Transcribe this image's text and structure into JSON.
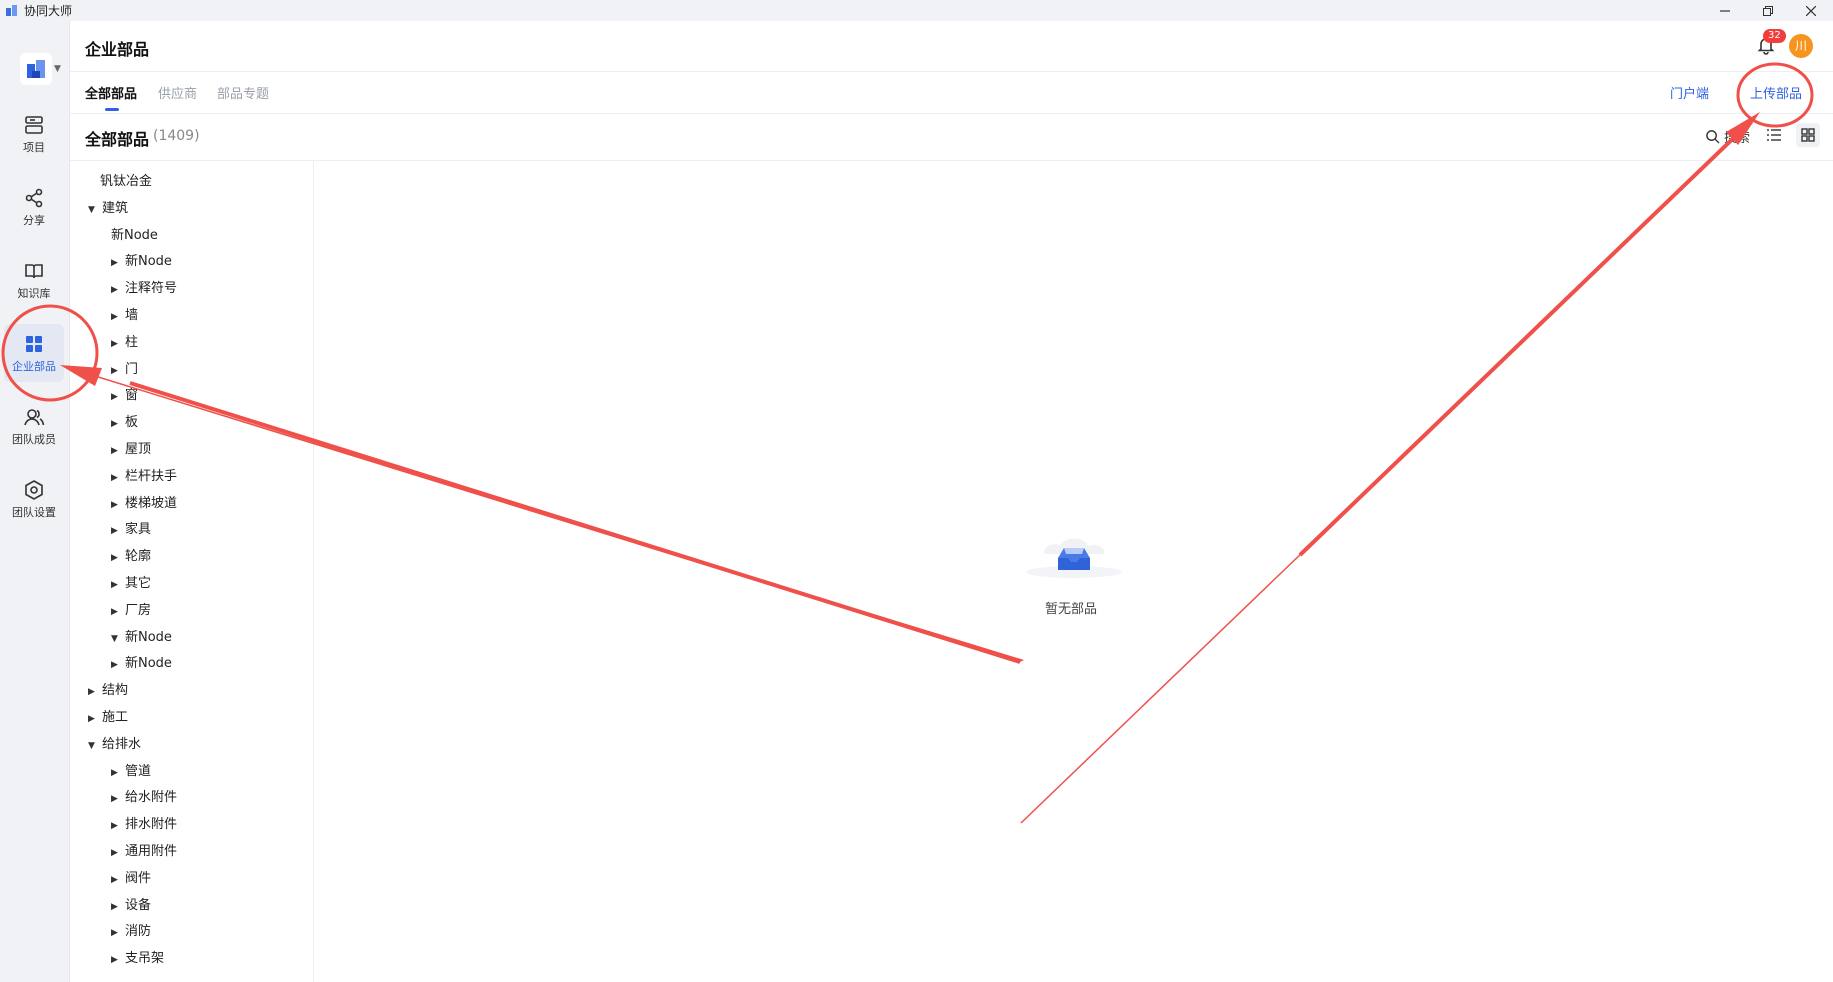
{
  "window": {
    "title": "协同大师"
  },
  "rail": {
    "items": [
      {
        "label": "项目",
        "icon": "project-icon"
      },
      {
        "label": "分享",
        "icon": "share-icon"
      },
      {
        "label": "知识库",
        "icon": "book-icon"
      },
      {
        "label": "企业部品",
        "icon": "grid-icon",
        "active": true
      },
      {
        "label": "团队成员",
        "icon": "team-icon"
      },
      {
        "label": "团队设置",
        "icon": "settings-icon"
      }
    ]
  },
  "header": {
    "title": "企业部品",
    "notification_count": "32",
    "avatar_text": "川"
  },
  "tabs": {
    "items": [
      "全部部品",
      "供应商",
      "部品专题"
    ],
    "portal_link": "门户端",
    "upload_button": "上传部品"
  },
  "section": {
    "title": "全部部品",
    "count": "(1409)",
    "search_label": "搜索"
  },
  "tree": [
    {
      "label": "钒钛冶金",
      "level": 0,
      "caret": "none"
    },
    {
      "label": "建筑",
      "level": 0,
      "caret": "open"
    },
    {
      "label": "新Node",
      "level": 1,
      "caret": "none"
    },
    {
      "label": "新Node",
      "level": 1,
      "caret": "closed"
    },
    {
      "label": "注释符号",
      "level": 1,
      "caret": "closed"
    },
    {
      "label": "墙",
      "level": 1,
      "caret": "closed"
    },
    {
      "label": "柱",
      "level": 1,
      "caret": "closed"
    },
    {
      "label": "门",
      "level": 1,
      "caret": "closed"
    },
    {
      "label": "窗",
      "level": 1,
      "caret": "closed"
    },
    {
      "label": "板",
      "level": 1,
      "caret": "closed"
    },
    {
      "label": "屋顶",
      "level": 1,
      "caret": "closed"
    },
    {
      "label": "栏杆扶手",
      "level": 1,
      "caret": "closed"
    },
    {
      "label": "楼梯坡道",
      "level": 1,
      "caret": "closed"
    },
    {
      "label": "家具",
      "level": 1,
      "caret": "closed"
    },
    {
      "label": "轮廓",
      "level": 1,
      "caret": "closed"
    },
    {
      "label": "其它",
      "level": 1,
      "caret": "closed"
    },
    {
      "label": "厂房",
      "level": 1,
      "caret": "closed"
    },
    {
      "label": "新Node",
      "level": 1,
      "caret": "open"
    },
    {
      "label": "新Node",
      "level": 1,
      "caret": "closed"
    },
    {
      "label": "结构",
      "level": 0,
      "caret": "closed"
    },
    {
      "label": "施工",
      "level": 0,
      "caret": "closed"
    },
    {
      "label": "给排水",
      "level": 0,
      "caret": "open"
    },
    {
      "label": "管道",
      "level": 1,
      "caret": "closed"
    },
    {
      "label": "给水附件",
      "level": 1,
      "caret": "closed"
    },
    {
      "label": "排水附件",
      "level": 1,
      "caret": "closed"
    },
    {
      "label": "通用附件",
      "level": 1,
      "caret": "closed"
    },
    {
      "label": "阀件",
      "level": 1,
      "caret": "closed"
    },
    {
      "label": "设备",
      "level": 1,
      "caret": "closed"
    },
    {
      "label": "消防",
      "level": 1,
      "caret": "closed"
    },
    {
      "label": "支吊架",
      "level": 1,
      "caret": "closed"
    }
  ],
  "empty_state": {
    "text": "暂无部品"
  },
  "colors": {
    "accent": "#2f62e0",
    "annotation": "#f0504a",
    "badge": "#f23d3d",
    "avatar": "#f7941d"
  }
}
